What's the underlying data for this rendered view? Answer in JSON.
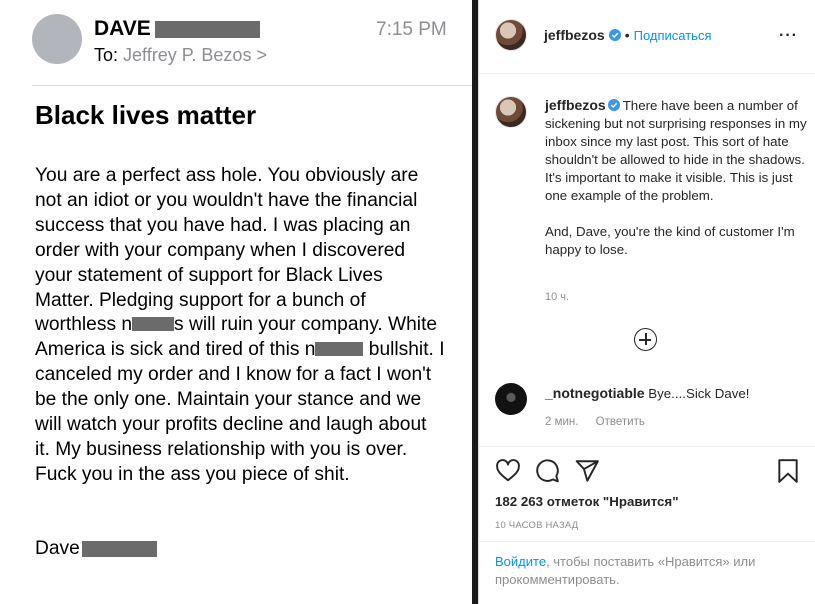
{
  "email": {
    "sender_name": "DAVE",
    "to_label": "To:",
    "to_name": "Jeffrey P. Bezos",
    "to_chevron": ">",
    "time": "7:15 PM",
    "subject": "Black lives matter",
    "body_part1": "You are a perfect ass hole. You obviously are not an idiot or you wouldn't have the financial success that you have had. I was placing an order with your company when I discovered your statement of support for Black Lives Matter. Pledging support for a bunch of worthless n",
    "body_part2": "s will ruin your company. White America is sick and tired of this n",
    "body_part3": " bullshit. I canceled my order and I know for a fact I won't be the only one. Maintain your stance and we will watch your profits decline and laugh about it. My business relationship with you is over. Fuck you in the ass you piece of shit.",
    "signature": "Dave"
  },
  "post": {
    "username": "jeffbezos",
    "separator": "•",
    "follow_label": "Подписаться",
    "more_icon": "more-options-icon",
    "caption_username": "jeffbezos",
    "caption_p1": "There have been a number of sickening but not surprising responses in my inbox since my last post. This sort of hate shouldn't be allowed to hide in the shadows. It's important to make it visible. This is just one example of the problem.",
    "caption_p2": "And, Dave, you're the kind of customer I'm happy to lose.",
    "caption_time": "10 ч.",
    "comment_username": "_notnegotiable",
    "comment_text": "Bye....Sick Dave!",
    "comment_time": "2 мин.",
    "comment_reply": "Ответить",
    "likes": "182 263 отметок \"Нравится\"",
    "posted_ago": "10 ЧАСОВ НАЗАД",
    "login_link": "Войдите",
    "login_rest": ", чтобы поставить «Нравится» или прокомментировать.",
    "colors": {
      "link": "#0095f6",
      "muted": "#8e8e8e",
      "text": "#262626",
      "verified": "#3897f0"
    }
  }
}
